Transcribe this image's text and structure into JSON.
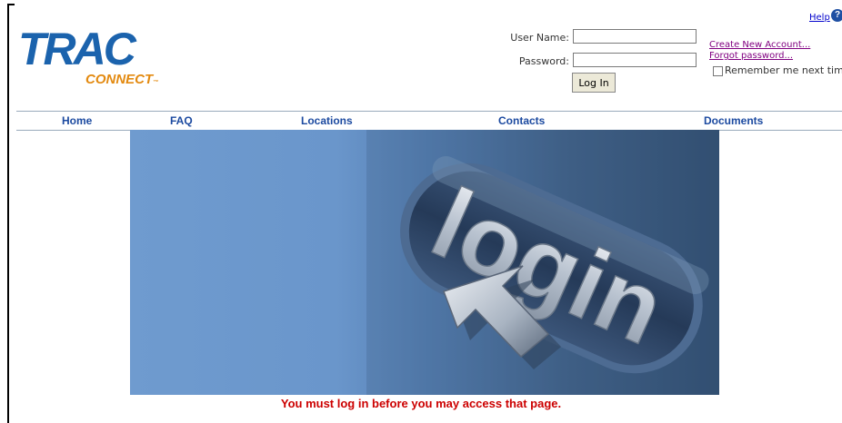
{
  "logo": {
    "primary": "TRAC",
    "secondary": "CONNECT",
    "trademark": "™"
  },
  "header": {
    "help_label": "Help",
    "help_icon": "question-icon"
  },
  "login": {
    "username_label": "User Name:",
    "username_value": "",
    "password_label": "Password:",
    "password_value": "",
    "button_label": "Log In",
    "create_account_label": "Create New Account...",
    "forgot_password_label": "Forgot password...",
    "remember_label": "Remember me next time",
    "remember_checked": false
  },
  "nav": {
    "items": [
      {
        "label": "Home"
      },
      {
        "label": "FAQ"
      },
      {
        "label": "Locations"
      },
      {
        "label": "Contacts"
      },
      {
        "label": "Documents"
      }
    ]
  },
  "hero": {
    "text": "login",
    "icon": "cursor-arrow-icon"
  },
  "error_message": "You must log in before you may access that page.",
  "colors": {
    "brand_blue": "#1b63ad",
    "brand_orange": "#e38a10",
    "nav_text": "#1c4aa0",
    "error": "#cc0000",
    "visited_link": "#800080"
  }
}
